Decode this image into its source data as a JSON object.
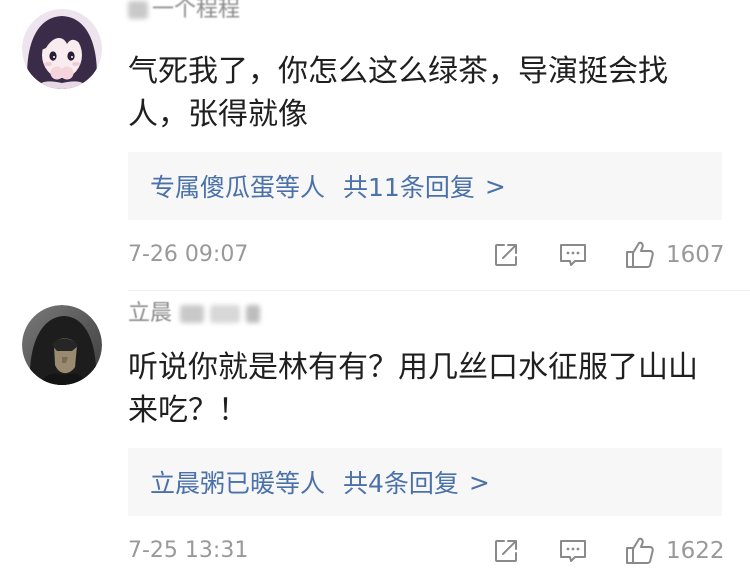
{
  "colors": {
    "text": "#1f1f1f",
    "username": "#8a8a8a",
    "link": "#4a71aa",
    "reply_bg": "#f7f7f7",
    "meta": "#999999",
    "icon": "#8a8a8a",
    "divider": "#efefef"
  },
  "comments": [
    {
      "user": {
        "name": "一个程程",
        "avatar_icon": "anime-girl-avatar"
      },
      "lines": [
        "气死我了，你怎么这么绿茶，导演挺会找",
        "人，张得就像"
      ],
      "replies": {
        "who": "专属傻瓜蛋等人",
        "count": "共11条回复",
        "arrow": ">"
      },
      "time": "7-26 09:07",
      "actions": {
        "forward_icon": "share-icon",
        "comment_icon": "comment-icon",
        "like_icon": "thumbs-up-icon",
        "likes": "1607"
      }
    },
    {
      "user": {
        "name": "立晨",
        "avatar_icon": "hooded-figure-avatar"
      },
      "lines": [
        "听说你就是林有有？用几丝口水征服了山山",
        "来吃？！"
      ],
      "replies": {
        "who": "立晨粥已暖等人",
        "count": "共4条回复",
        "arrow": ">"
      },
      "time": "7-25 13:31",
      "actions": {
        "forward_icon": "share-icon",
        "comment_icon": "comment-icon",
        "like_icon": "thumbs-up-icon",
        "likes": "1622"
      }
    }
  ]
}
